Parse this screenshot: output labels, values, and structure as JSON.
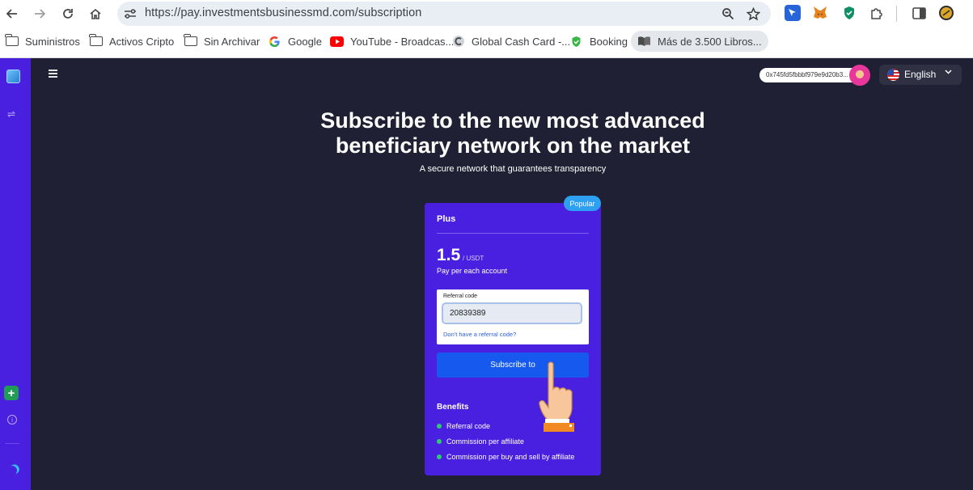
{
  "browser": {
    "url": "https://pay.investmentsbusinessmd.com/subscription",
    "bookmarks": [
      {
        "label": "Suministros",
        "icon": "folder-icon"
      },
      {
        "label": "Activos Cripto",
        "icon": "folder-icon"
      },
      {
        "label": "Sin Archivar",
        "icon": "folder-icon"
      },
      {
        "label": "Google",
        "icon": "google-icon"
      },
      {
        "label": "YouTube - Broadcas...",
        "icon": "youtube-icon"
      },
      {
        "label": "Global Cash Card -...",
        "icon": "global-cash-icon"
      },
      {
        "label": "Booking",
        "icon": "shield-icon"
      },
      {
        "label": "Más de 3.500 Libros...",
        "icon": "book-icon"
      }
    ]
  },
  "header": {
    "wallet_address": "0x745fd5fbbbf979e9d20b3...",
    "language": "English"
  },
  "hero": {
    "title": "Subscribe to the new most advanced beneficiary network on the market",
    "subtitle": "A secure network that guarantees transparency"
  },
  "card": {
    "badge": "Popular",
    "plan_name": "Plus",
    "price": "1.5",
    "price_unit": "/ USDT",
    "price_desc": "Pay per each account",
    "referral": {
      "label": "Referral code",
      "value": "20839389",
      "link": "Don't have a referral code?"
    },
    "subscribe_label": "Subscribe to",
    "benefits_title": "Benefits",
    "benefits": [
      "Referral code",
      "Commission per affiliate",
      "Commission per buy and sell by affiliate"
    ]
  },
  "colors": {
    "sidebar": "#4a20e0",
    "card": "#4a20e0",
    "background": "#1f2033",
    "button": "#1559ef",
    "badge": "#2ea0f2",
    "benefit_dot": "#2ecc71"
  }
}
